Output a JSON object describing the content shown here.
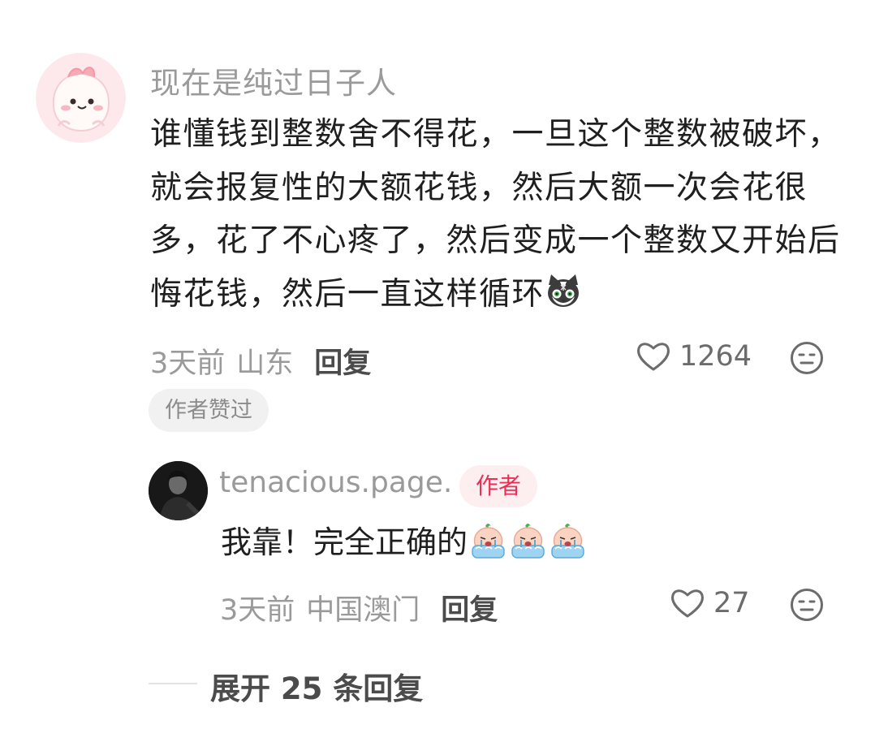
{
  "comment": {
    "username": "现在是纯过日子人",
    "text": "谁懂钱到整数舍不得花，一旦这个整数被破坏，就会报复性的大额花钱，然后大额一次会花很多，花了不心疼了，然后变成一个整数又开始后悔花钱，然后一直这样循环",
    "time": "3天前",
    "location": "山东",
    "reply_label": "回复",
    "likes": "1264",
    "author_liked_badge": "作者赞过"
  },
  "reply": {
    "username": "tenacious.page.",
    "author_badge": "作者",
    "text": "我靠！完全正确的",
    "time": "3天前",
    "location": "中国澳门",
    "reply_label": "回复",
    "likes": "27"
  },
  "expand": {
    "label": "展开 25 条回复"
  },
  "colors": {
    "meta_gray": "#9a9a9a",
    "author_badge_text": "#f02d52",
    "author_badge_bg": "#fdeef0",
    "liked_badge_bg": "#f1f1f1"
  }
}
